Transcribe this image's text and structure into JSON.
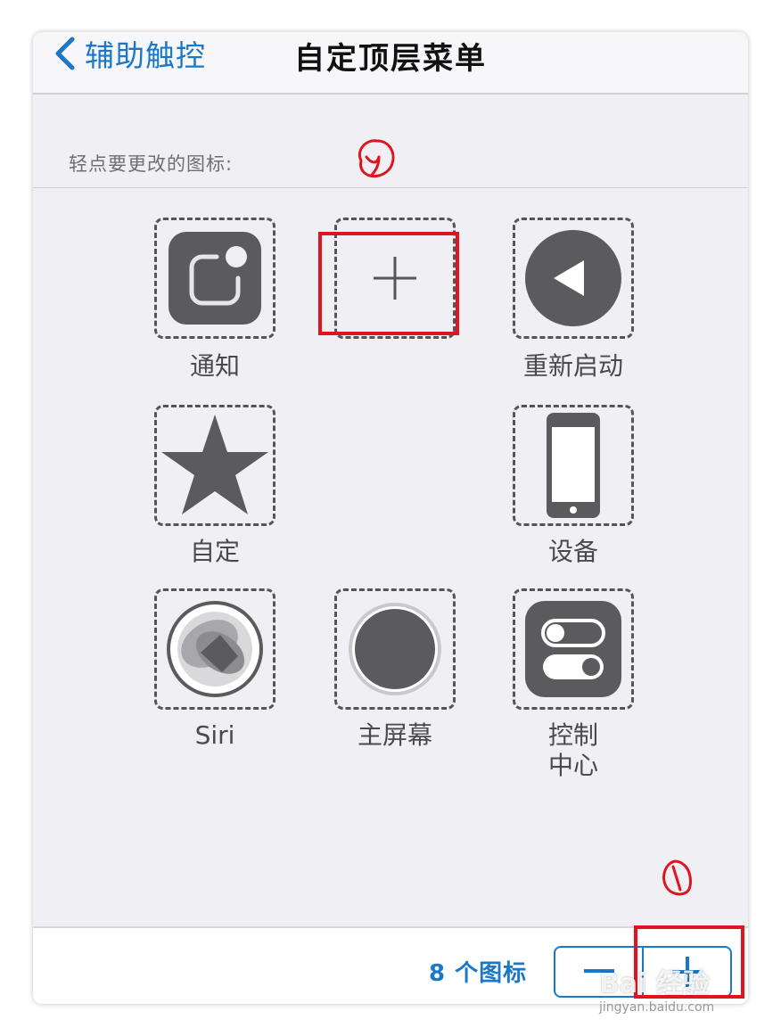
{
  "navbar": {
    "back_label": "辅助触控",
    "title": "自定顶层菜单"
  },
  "section": {
    "header": "轻点要更改的图标:"
  },
  "grid": {
    "items": [
      {
        "label": "通知",
        "icon": "notification-icon"
      },
      {
        "label": "",
        "icon": "plus-icon"
      },
      {
        "label": "重新启动",
        "icon": "restart-icon"
      },
      {
        "label": "自定",
        "icon": "star-icon"
      },
      {
        "label": "设备",
        "icon": "device-icon"
      },
      {
        "label": "Siri",
        "icon": "siri-icon"
      },
      {
        "label": "主屏幕",
        "icon": "home-button-icon"
      },
      {
        "label": "控制",
        "label2": "中心",
        "icon": "control-center-icon"
      }
    ]
  },
  "footer": {
    "count_label": "8 个图标",
    "minus_label": "—",
    "plus_label": "+"
  },
  "annotations": {
    "step1_mark": "circled-2",
    "step2_mark": "circled-1",
    "highlight_color": "#e0141e"
  },
  "watermark": {
    "brand": "Bai 经验",
    "url": "jingyan.baidu.com"
  },
  "colors": {
    "accent": "#1b77c8",
    "icon_fill": "#5b5b5e",
    "background": "#efeff4"
  }
}
